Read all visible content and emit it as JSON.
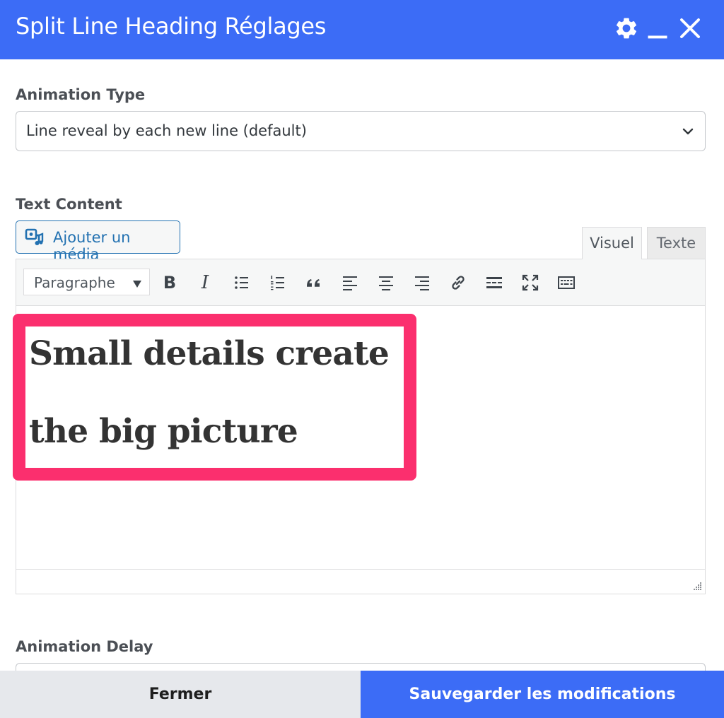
{
  "header": {
    "title": "Split Line Heading Réglages",
    "background": "#3c6cf6",
    "icons": [
      "gear-icon",
      "minimize-icon",
      "close-icon"
    ]
  },
  "animation_type": {
    "label": "Animation Type",
    "selected": "Line reveal by each new line (default)"
  },
  "text_content": {
    "label": "Text Content",
    "add_media_label": "Ajouter un média",
    "tabs": [
      {
        "label": "Visuel",
        "active": true
      },
      {
        "label": "Texte",
        "active": false
      }
    ],
    "toolbar": {
      "format_select": "Paragraphe",
      "bold_label": "B",
      "italic_label": "I",
      "buttons": [
        "bold-icon",
        "italic-icon",
        "bullet-list-icon",
        "numbered-list-icon",
        "blockquote-icon",
        "align-left-icon",
        "align-center-icon",
        "align-right-icon",
        "link-icon",
        "read-more-icon",
        "fullscreen-icon",
        "toolbar-toggle-icon"
      ]
    },
    "content_lines": [
      "Small details create",
      "the big picture"
    ],
    "highlight_color": "#fb2f6e"
  },
  "animation_delay": {
    "label": "Animation Delay"
  },
  "footer": {
    "close_label": "Fermer",
    "save_label": "Sauvegarder les modifications",
    "save_color": "#3c6cf6"
  }
}
